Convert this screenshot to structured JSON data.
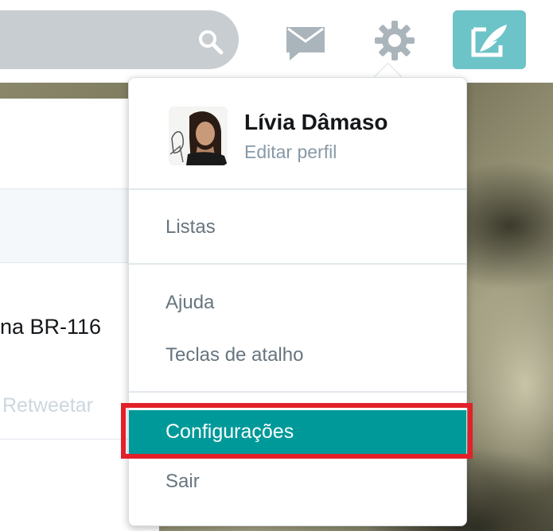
{
  "topbar": {
    "icons": {
      "search": "search-icon",
      "messages": "mail-icon",
      "settings": "gear-icon",
      "compose": "compose-tweet-icon"
    },
    "colors": {
      "search_box": "#c8cdd1",
      "compose_button": "#6cc3c8"
    }
  },
  "timeline": {
    "tweet_text": "na BR-116",
    "retweet_label": "Retweetar"
  },
  "dropdown": {
    "user_name": "Lívia Dâmaso",
    "edit_profile": "Editar perfil",
    "items": [
      {
        "label": "Listas"
      },
      {
        "label": "Ajuda"
      },
      {
        "label": "Teclas de atalho"
      },
      {
        "label": "Configurações",
        "highlighted": true
      },
      {
        "label": "Sair"
      }
    ],
    "colors": {
      "highlight": "#009999",
      "outline": "#e2202a"
    }
  }
}
